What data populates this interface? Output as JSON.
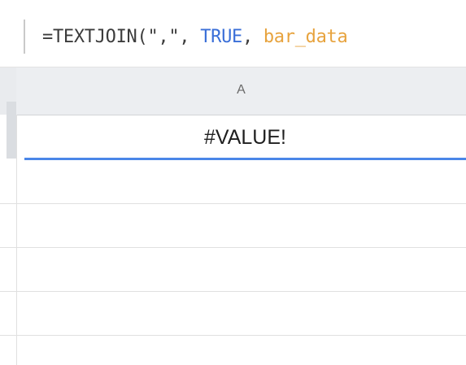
{
  "formula_bar": {
    "prefix": "=TEXTJOIN(\",\", ",
    "bool_arg": "TRUE",
    "sep": ", ",
    "range_arg": "bar_data"
  },
  "columns": [
    {
      "label": "A"
    }
  ],
  "cells": {
    "A1": "#VALUE!"
  },
  "colors": {
    "selection_border": "#4a86e8",
    "bool_token": "#3a6fd8",
    "range_token": "#e7a33e",
    "header_bg": "#eceef1"
  }
}
